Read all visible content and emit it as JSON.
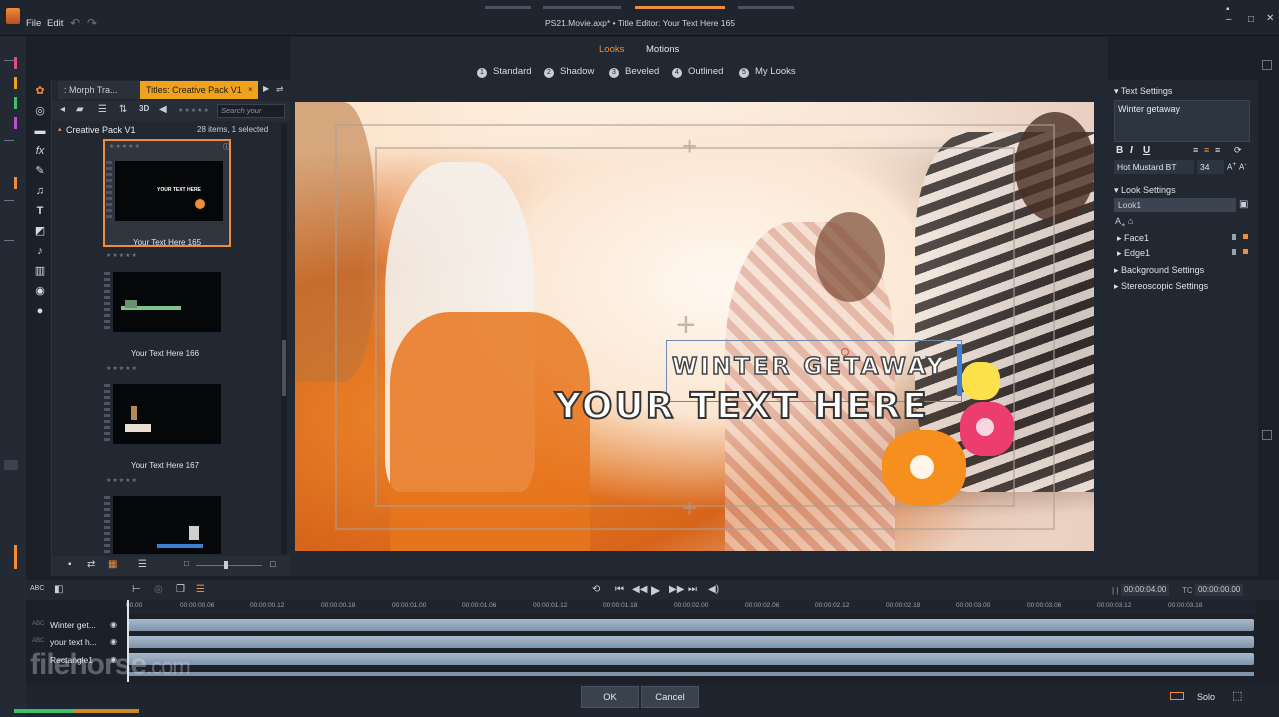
{
  "menu": {
    "file": "File",
    "edit": "Edit"
  },
  "document_title": "PS21.Movie.axp* • Title Editor: Your Text Here 165",
  "library": {
    "tabs": [
      {
        "label": ": Morph Tra..."
      },
      {
        "label": "Titles: Creative Pack V1"
      }
    ],
    "toolbar_3d": "3D",
    "search_placeholder": "Search your",
    "pack_name": "Creative Pack V1",
    "pack_count": "28 items, 1 selected",
    "items": [
      {
        "label": "Your Text Here 165",
        "selected": true
      },
      {
        "label": "Your Text Here 166",
        "selected": false
      },
      {
        "label": "Your Text Here 167",
        "selected": false
      }
    ],
    "thumb_small_title": "YOUR TEXT HERE"
  },
  "looks": {
    "tabs": [
      {
        "label": "Looks",
        "active": true
      },
      {
        "label": "Motions",
        "active": false
      }
    ],
    "presets": [
      {
        "num": "1",
        "label": "Standard"
      },
      {
        "num": "2",
        "label": "Shadow"
      },
      {
        "num": "3",
        "label": "Beveled"
      },
      {
        "num": "4",
        "label": "Outlined"
      },
      {
        "num": "5",
        "label": "My Looks"
      }
    ]
  },
  "preview": {
    "title_line1": "WINTER GETAWAY",
    "title_line2": "YOUR TEXT HERE"
  },
  "text_settings": {
    "header": "Text Settings",
    "text_value": "Winter getaway",
    "bold": "B",
    "italic": "I",
    "underline": "U",
    "font": "Hot Mustard BT",
    "size": "34"
  },
  "look_settings": {
    "header": "Look Settings",
    "look_name": "Look1",
    "layers": [
      {
        "label": "Face1"
      },
      {
        "label": "Edge1"
      }
    ]
  },
  "background_settings": "Background Settings",
  "stereoscopic_settings": "Stereoscopic Settings",
  "timeline": {
    "timecode_left": "00:00:04.00",
    "tc_label": "TC",
    "timecode_right": "00:00:00.00",
    "ticks": [
      "00.00",
      "00:00:00.06",
      "00:00:00.12",
      "00:00:00.18",
      "00:00:01.00",
      "00:00:01.06",
      "00:00:01.12",
      "00:00:01.18",
      "00:00:02.00",
      "00:00:02.06",
      "00:00:02.12",
      "00:00:02.18",
      "00:00:03.00",
      "00:00:03.06",
      "00:00:03.12",
      "00:00:03.18"
    ],
    "tracks": [
      {
        "name": "Winter get..."
      },
      {
        "name": "your text h..."
      },
      {
        "name": "Rectangle1"
      }
    ]
  },
  "buttons": {
    "ok": "OK",
    "cancel": "Cancel",
    "solo": "Solo"
  },
  "watermark": {
    "main": "filehorse",
    "suffix": ".com"
  },
  "colors": {
    "accent": "#f08c3a",
    "tab_active": "#f0a21a",
    "panel": "#222831"
  }
}
